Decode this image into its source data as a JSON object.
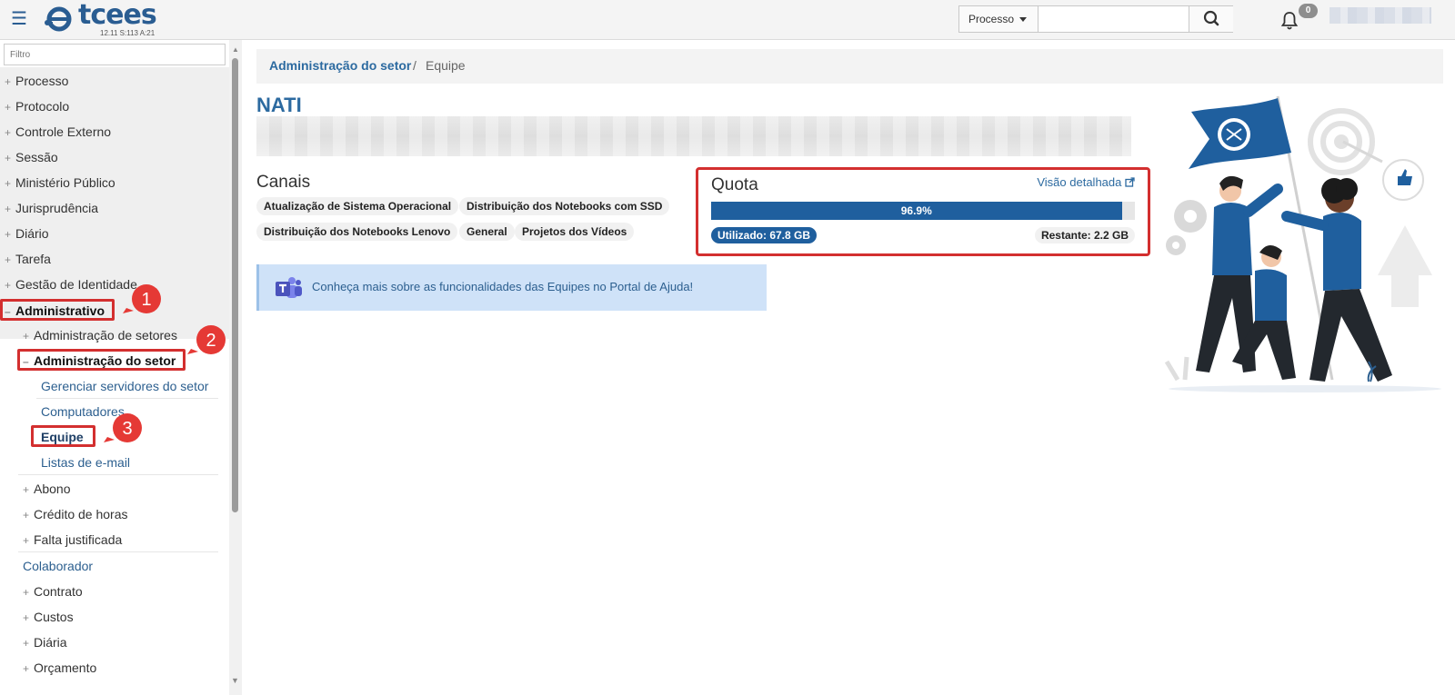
{
  "app": {
    "logo_text": "tcees",
    "version": "12.11 S:113 A:21",
    "notifications_count": "0"
  },
  "search": {
    "type_label": "Processo",
    "placeholder": ""
  },
  "sidebar": {
    "filter_placeholder": "Filtro",
    "items": [
      {
        "label": "Processo"
      },
      {
        "label": "Protocolo"
      },
      {
        "label": "Controle Externo"
      },
      {
        "label": "Sessão"
      },
      {
        "label": "Ministério Público"
      },
      {
        "label": "Jurisprudência"
      },
      {
        "label": "Diário"
      },
      {
        "label": "Tarefa"
      },
      {
        "label": "Gestão de Identidade"
      }
    ],
    "admin": {
      "label": "Administrativo",
      "setores": "Administração de setores",
      "setor": "Administração do setor",
      "setor_children": [
        {
          "label": "Gerenciar servidores do setor"
        },
        {
          "label": "Computadores"
        },
        {
          "label": "Equipe"
        },
        {
          "label": "Listas de e-mail"
        }
      ],
      "more": [
        {
          "label": "Abono"
        },
        {
          "label": "Crédito de horas"
        },
        {
          "label": "Falta justificada"
        },
        {
          "label": "Colaborador"
        },
        {
          "label": "Contrato"
        },
        {
          "label": "Custos"
        },
        {
          "label": "Diária"
        },
        {
          "label": "Orçamento"
        }
      ]
    },
    "callouts": [
      "1",
      "2",
      "3"
    ]
  },
  "breadcrumb": {
    "parent": "Administração do setor",
    "separator": "/",
    "current": "Equipe"
  },
  "team": {
    "name": "NATI"
  },
  "canais": {
    "title": "Canais",
    "chips": [
      "Atualização de Sistema Operacional",
      "Distribuição dos Notebooks com SSD",
      "Distribuição dos Notebooks Lenovo",
      "General",
      "Projetos dos Vídeos"
    ]
  },
  "quota": {
    "title": "Quota",
    "detail_link": "Visão detalhada",
    "percent": 96.9,
    "percent_label": "96.9%",
    "used": "Utilizado: 67.8 GB",
    "remaining": "Restante: 2.2 GB"
  },
  "help": {
    "text": "Conheça mais sobre as funcionalidades das Equipes no Portal de Ajuda!"
  },
  "colors": {
    "brand": "#2a5d92",
    "link": "#2c6aa0",
    "progress": "#1f5f9e",
    "annotation": "#d32f2f",
    "help_bg": "#cfe2f8"
  }
}
